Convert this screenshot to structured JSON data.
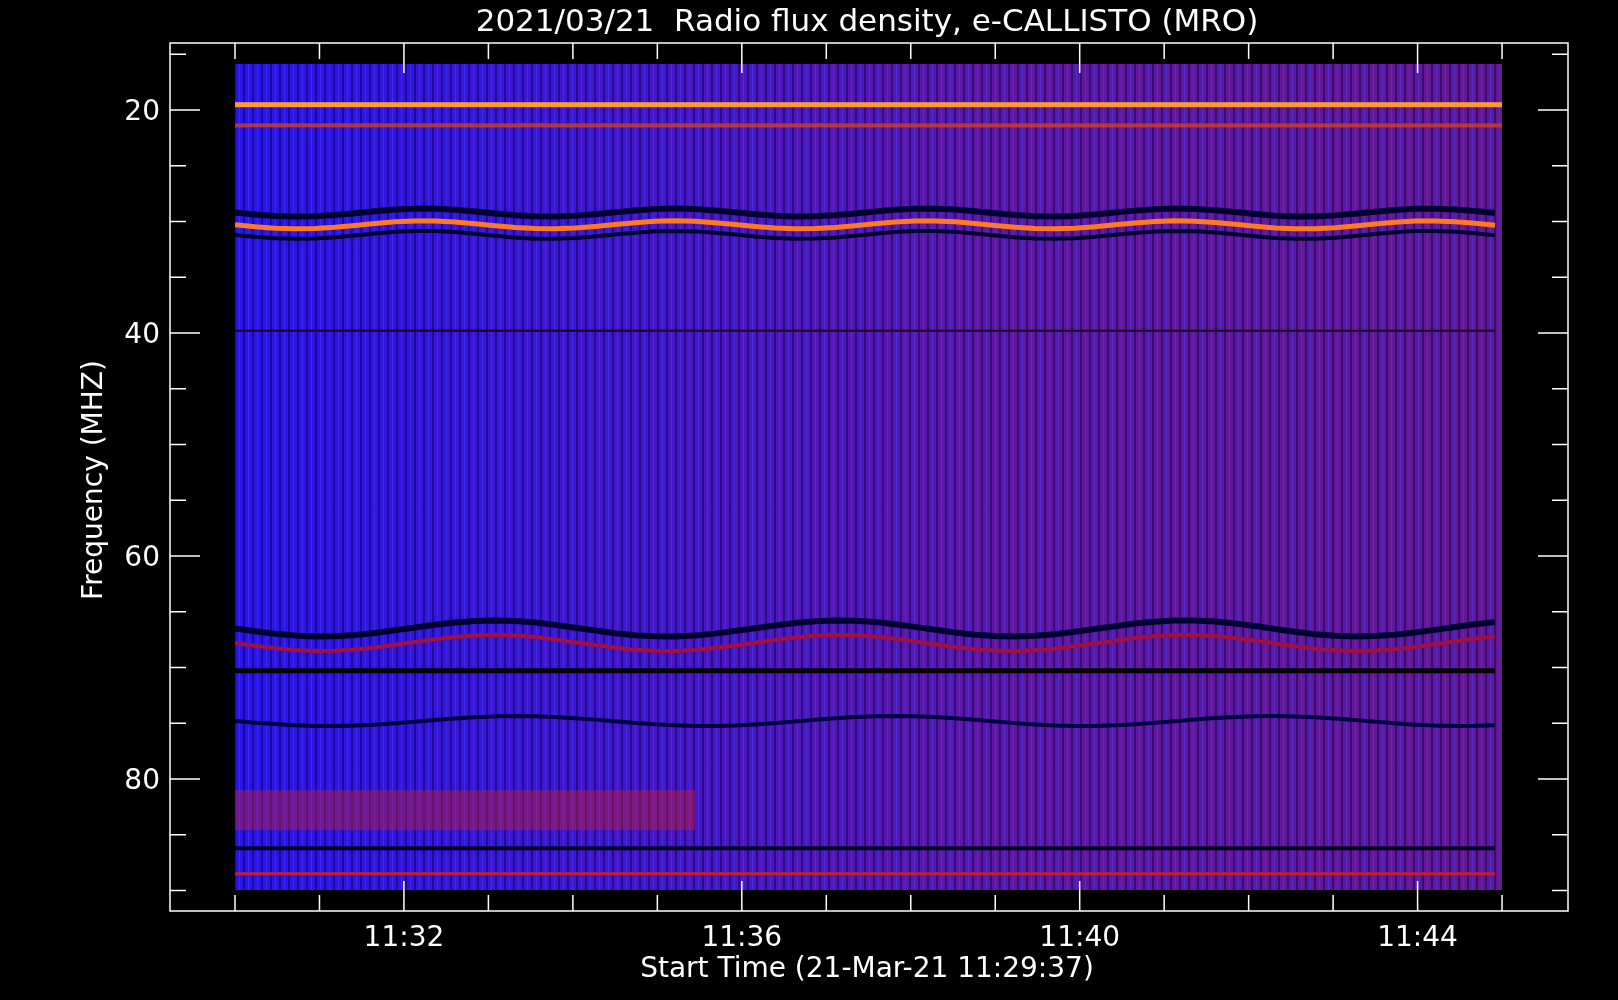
{
  "plot": {
    "title": "2021/03/21  Radio flux density, e-CALLISTO (MRO)",
    "ylabel": "Frequency (MHZ)",
    "xlabel": "Start Time (21-Mar-21 11:29:37)",
    "yticks": [
      "20",
      "40",
      "60",
      "80"
    ],
    "xticks": [
      "11:32",
      "11:36",
      "11:40",
      "11:44"
    ]
  }
}
